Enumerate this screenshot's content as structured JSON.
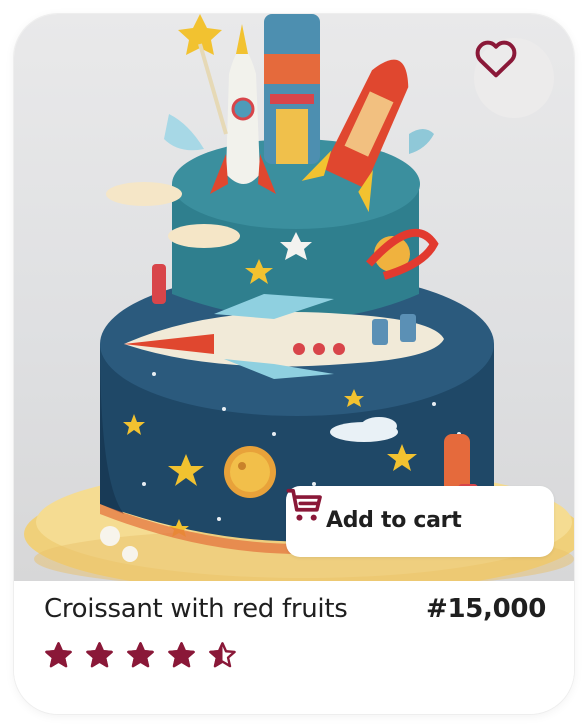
{
  "product": {
    "name": "Croissant with red fruits",
    "price": "#15,000",
    "rating": 4.5,
    "rating_max": 5
  },
  "actions": {
    "add_to_cart_label": "Add to cart"
  },
  "icons": {
    "favorite": "heart-outline-icon",
    "cart": "shopping-cart-icon",
    "star": "star-icon"
  },
  "colors": {
    "accent": "#8a1838",
    "text": "#1f1f1f",
    "fav_bg": "#ecebeb"
  },
  "image": {
    "subject": "space-themed two-tier cake with rockets, stars and planets"
  }
}
